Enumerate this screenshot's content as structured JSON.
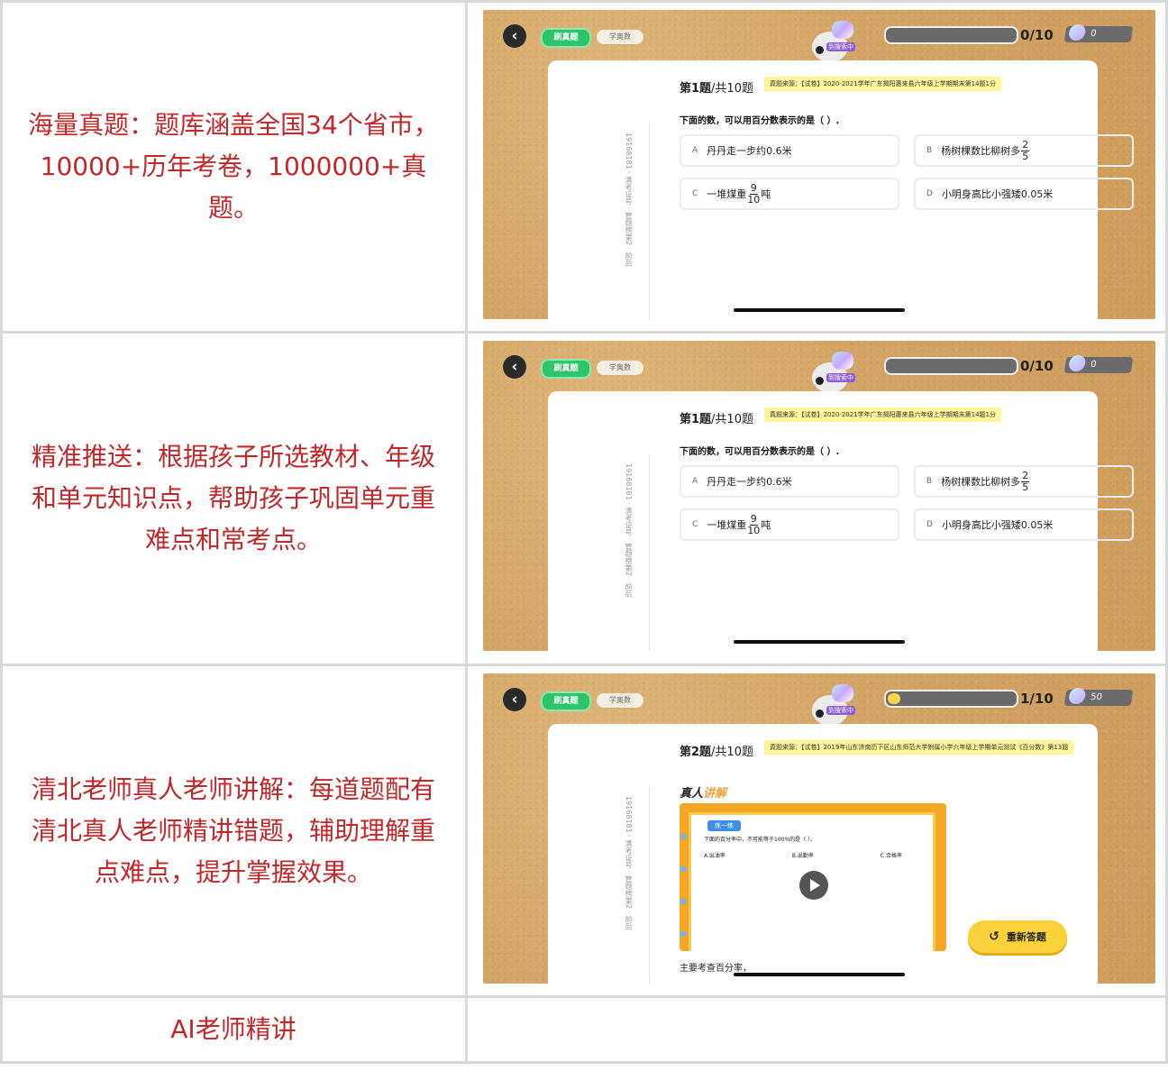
{
  "rows": [
    {
      "text": "海量真题：题库涵盖全国34个省市，10000+历年考卷，1000000+真题。"
    },
    {
      "text": "精准推送：根据孩子所选教材、年级和单元知识点，帮助孩子巩固单元重难点和常考点。"
    },
    {
      "text": "清北老师真人老师讲解：每道题配有清北真人老师精讲错题，辅助理解重点难点，提升掌握效果。"
    },
    {
      "text": "AI老师精讲"
    }
  ],
  "app": {
    "tab_active": "刷真题",
    "tab_inactive": "学奥数",
    "mascot_label": "到搜索中",
    "sidebar": "19168181 · 清考证号 · 管题榜第2 · 前后"
  },
  "shot1": {
    "progress_label": "0/10",
    "progress_value": 0,
    "coins": "0",
    "q_number": "第1题",
    "q_total": "/共10题",
    "source": "真题来源：【试卷】2020-2021学年广东揭阳惠来县六年级上学期期末第14题1分",
    "question": "下面的数，可以用百分数表示的是（ ）.",
    "options": [
      {
        "key": "A",
        "text": "丹丹走一步约0.6米"
      },
      {
        "key": "B",
        "text": "杨树棵数比柳树多",
        "frac_n": "2",
        "frac_d": "5"
      },
      {
        "key": "C",
        "text": "一堆煤重",
        "frac_n": "9",
        "frac_d": "10",
        "suffix": "吨"
      },
      {
        "key": "D",
        "text": "小明身高比小强矮0.05米"
      }
    ]
  },
  "shot2": {
    "progress_label": "0/10",
    "progress_value": 0,
    "coins": "0",
    "q_number": "第1题",
    "q_total": "/共10题",
    "source": "真题来源：【试卷】2020-2021学年广东揭阳惠来县六年级上学期期末第14题1分",
    "question": "下面的数，可以用百分数表示的是（ ）.",
    "options": [
      {
        "key": "A",
        "text": "丹丹走一步约0.6米"
      },
      {
        "key": "B",
        "text": "杨树棵数比柳树多",
        "frac_n": "2",
        "frac_d": "5"
      },
      {
        "key": "C",
        "text": "一堆煤重",
        "frac_n": "9",
        "frac_d": "10",
        "suffix": "吨"
      },
      {
        "key": "D",
        "text": "小明身高比小强矮0.05米"
      }
    ]
  },
  "shot3": {
    "progress_label": "1/10",
    "progress_value": 0.1,
    "coins": "50",
    "q_number": "第2题",
    "q_total": "/共10题",
    "source": "真题来源：【试卷】2019年山东济南历下区山东师范大学附属小学六年级上学期单元测试《百分数》第13题",
    "explain_title_a": "真人",
    "explain_title_b": "讲解",
    "video_tag": "练一练",
    "video_question": "下面的百分率中，不可能等于100%的是（ ）。",
    "video_options": [
      "A.出油率",
      "B.出勤率",
      "C.合格率"
    ],
    "redo_label": "重新答题",
    "note": "主要考查百分率，"
  }
}
